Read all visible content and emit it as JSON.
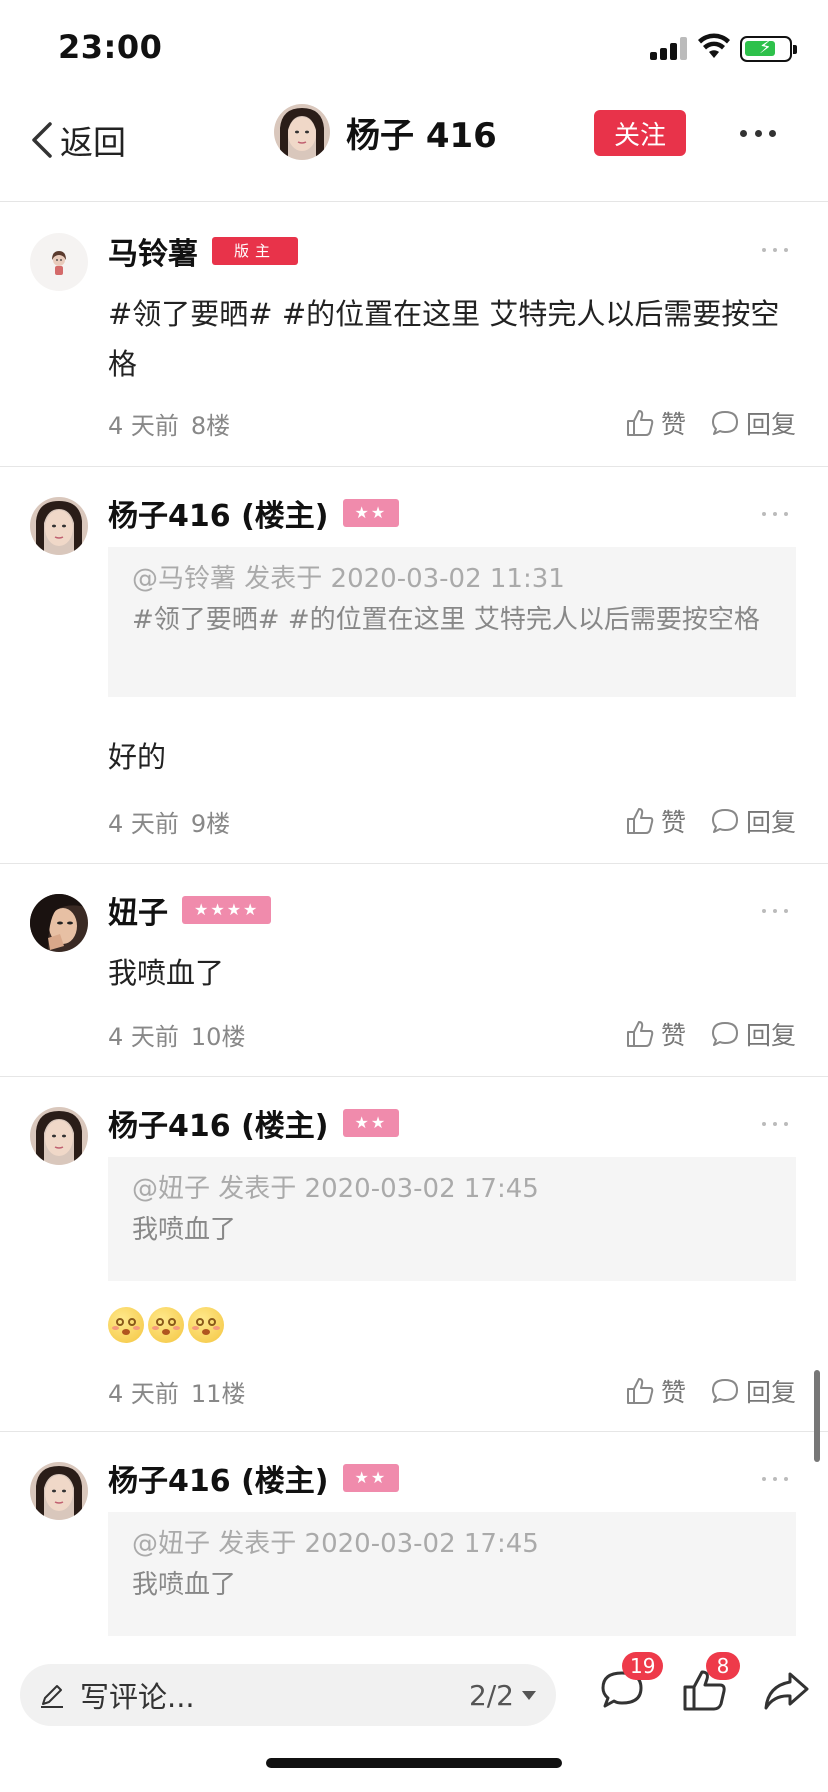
{
  "status_bar": {
    "time": "23:00"
  },
  "nav": {
    "back_label": "返回",
    "user_name": "杨子 416",
    "follow_label": "关注"
  },
  "comments": [
    {
      "name": "马铃薯",
      "badge": "版主",
      "badge_type": "moderator",
      "text": "#领了要晒# #的位置在这里 艾特完人以后需要按空格",
      "time": "4 天前",
      "floor": "8楼",
      "like_label": "赞",
      "reply_label": "回复"
    },
    {
      "name": "杨子416 (楼主)",
      "badge": "★★",
      "badge_type": "stars",
      "quote_meta": "@马铃薯 发表于 2020-03-02 11:31",
      "quote_text": "#领了要晒# #的位置在这里 艾特完人以后需要按空格",
      "text": "好的",
      "time": "4 天前",
      "floor": "9楼",
      "like_label": "赞",
      "reply_label": "回复"
    },
    {
      "name": "妞子",
      "badge": "★★★★",
      "badge_type": "stars",
      "text": "我喷血了",
      "time": "4 天前",
      "floor": "10楼",
      "like_label": "赞",
      "reply_label": "回复"
    },
    {
      "name": "杨子416 (楼主)",
      "badge": "★★",
      "badge_type": "stars",
      "quote_meta": "@妞子 发表于 2020-03-02 17:45",
      "quote_text": "我喷血了",
      "emoji": [
        "blush-emoji",
        "blush-emoji",
        "blush-emoji"
      ],
      "time": "4 天前",
      "floor": "11楼",
      "like_label": "赞",
      "reply_label": "回复"
    },
    {
      "name": "杨子416 (楼主)",
      "badge": "★★",
      "badge_type": "stars",
      "quote_meta": "@妞子 发表于 2020-03-02 17:45",
      "quote_text": "我喷血了"
    }
  ],
  "bottom_bar": {
    "comment_placeholder": "写评论...",
    "page_indicator": "2/2",
    "comment_count": "19",
    "like_count": "8"
  },
  "colors": {
    "accent_red": "#e8334a",
    "star_badge_pink": "#f08bac",
    "badge_red": "#ee3a4a"
  }
}
